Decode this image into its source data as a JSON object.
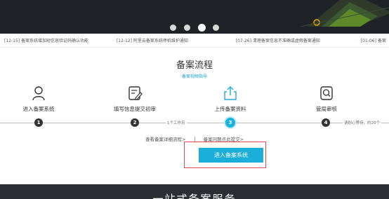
{
  "banner": {
    "carousel_dots": 4,
    "active_dot": 3
  },
  "notices": [
    {
      "date": "[12-15]",
      "text": "备案系统增加短信息验证码确认功能"
    },
    {
      "date": "[12-12]",
      "text": "阿里云备案系统停机维护通知"
    },
    {
      "date": "[07-26]",
      "text": "清理备案信息不准确或虚假备案通知"
    },
    {
      "date": "[01-06]",
      "text": "备案"
    }
  ],
  "process": {
    "title": "备案流程",
    "video_guide": "备案视频指导",
    "steps": [
      {
        "label": "进入备案系统",
        "number": "1"
      },
      {
        "label": "填写信息提交初审",
        "number": "2"
      },
      {
        "label": "上传备案资料",
        "number": "3"
      },
      {
        "label": "管局审核",
        "number": "4"
      }
    ],
    "timeline_labels": {
      "between_2_3": "1个工作日",
      "after_4": "请耐心等待，约20个"
    },
    "links": {
      "detail_flow": "查看备案详细流程>",
      "faq": "备案问题点此提交>"
    },
    "cta_button": "进入备案系统"
  },
  "bottom": {
    "title": "一站式备案服务"
  },
  "colors": {
    "accent": "#1aaed9",
    "highlight_border": "#e24b4b",
    "banner_bg": "#1f2226"
  }
}
